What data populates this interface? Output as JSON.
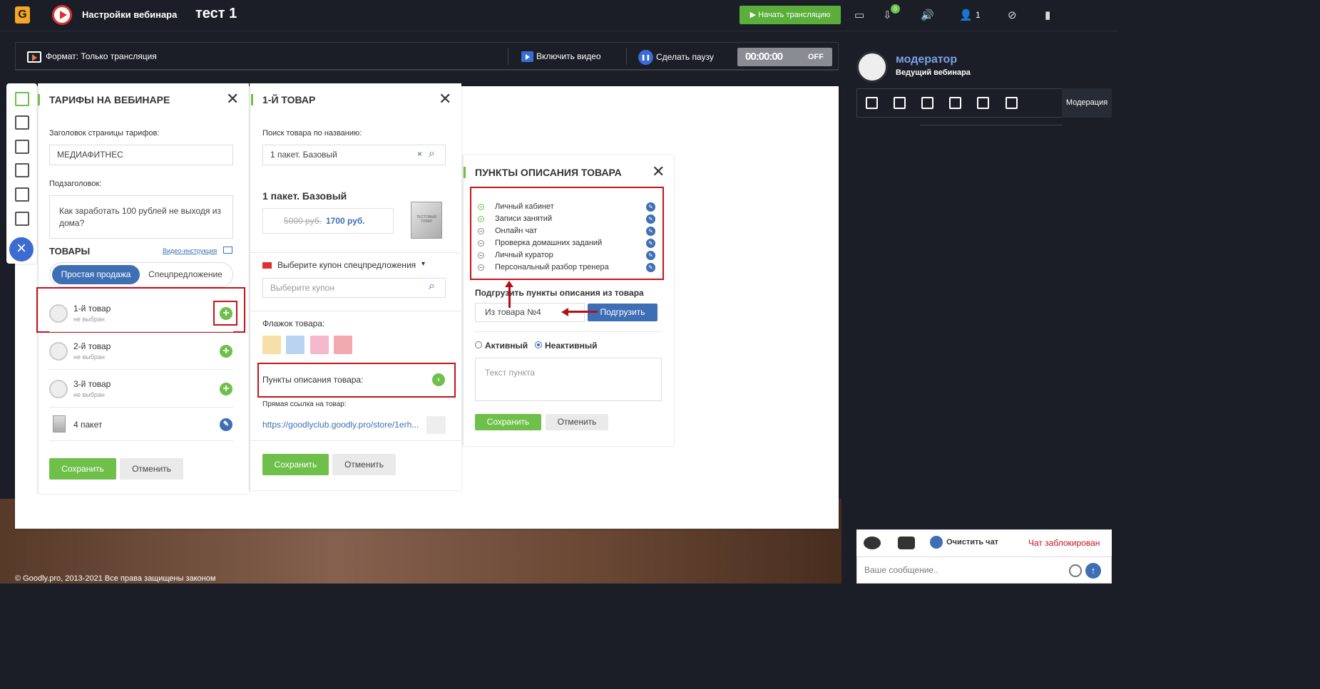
{
  "topbar": {
    "logo": "G",
    "title": "Настройки вебинара",
    "webinar_name": "тест 1",
    "start_button": "Начать трансляцию",
    "badge_count": "0",
    "participants": "1"
  },
  "format_bar": {
    "format": "Формат: Только трансляция",
    "video_button": "Включить видео",
    "pause_button": "Сделать паузу",
    "timer": "00:00:00",
    "off": "OFF"
  },
  "tariffs_panel": {
    "title": "ТАРИФЫ НА ВЕБИНАРЕ",
    "page_title_label": "Заголовок страницы тарифов:",
    "page_title_value": "МЕДИАФИТНЕС",
    "subtitle_label": "Подзаголовок:",
    "subtitle_value": "Как заработать 100 рублей не выходя из дома?",
    "goods_heading": "ТОВАРЫ",
    "video_guide": "Видео-инструкция",
    "tabs": [
      "Простая продажа",
      "Спецпредложение"
    ],
    "items": [
      {
        "name": "1-й товар",
        "sub": "не выбран"
      },
      {
        "name": "2-й товар",
        "sub": "не выбран"
      },
      {
        "name": "3-й товар",
        "sub": "не выбран"
      },
      {
        "name": "4 пакет",
        "sub": ""
      }
    ],
    "save": "Сохранить",
    "cancel": "Отменить"
  },
  "product_panel": {
    "title": "1-Й ТОВАР",
    "search_label": "Поиск товара по названию:",
    "search_value": "1 пакет. Базовый",
    "product_name": "1 пакет. Базовый",
    "old_price": "5000 руб.",
    "new_price": "1700 руб.",
    "box_text": "ТЕСТОВЫЙ ТОВАР",
    "coupon_label": "Выберите купон спецпредложения",
    "coupon_placeholder": "Выберите купон",
    "flag_label": "Флажок товара:",
    "desc_points_label": "Пункты описания товара:",
    "link_label": "Прямая ссылка на товар:",
    "link_value": "https://goodlyclub.goodly.pro/store/1erh...",
    "save": "Сохранить",
    "cancel": "Отменить",
    "flag_colors": [
      "#f7e0a8",
      "#b9d3f0",
      "#f4b7cc",
      "#f3a9b0"
    ]
  },
  "desc_panel": {
    "title": "ПУНКТЫ ОПИСАНИЯ ТОВАРА",
    "points": [
      {
        "text": "Личный кабинет",
        "active": true
      },
      {
        "text": "Записи занятий",
        "active": true
      },
      {
        "text": "Онлайн чат",
        "active": false
      },
      {
        "text": "Проверка домашних заданий",
        "active": false
      },
      {
        "text": "Личный куратор",
        "active": false
      },
      {
        "text": "Персональный разбор тренера",
        "active": false
      }
    ],
    "load_label": "Подгрузить пункты описания из товара",
    "load_value": "Из товара №4",
    "load_button": "Подгрузить",
    "radio_active": "Активный",
    "radio_inactive": "Неактивный",
    "text_placeholder": "Текст пункта",
    "save": "Сохранить",
    "cancel": "Отменить"
  },
  "right_panel": {
    "moderator_name": "модератор",
    "moderator_role": "Ведущий вебинара",
    "mod_tab": "Модерация",
    "clear_chat": "Очистить чат",
    "chat_locked": "Чат заблокирован",
    "message_placeholder": "Ваше сообщение.."
  },
  "footer": {
    "copyright": "© Goodly.pro, 2013-2021 Все права защищены законом"
  }
}
